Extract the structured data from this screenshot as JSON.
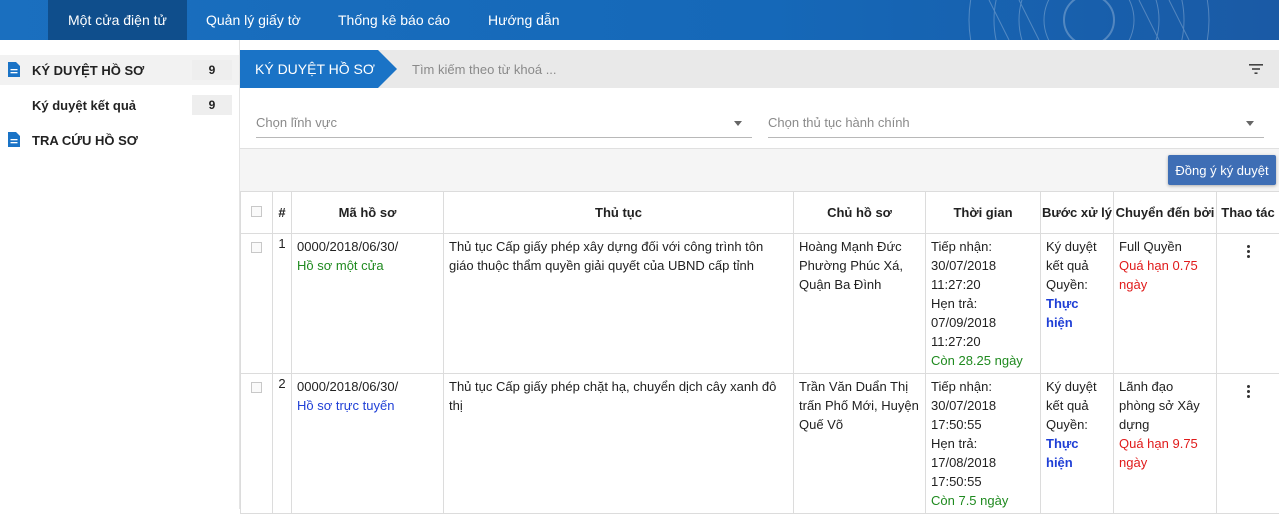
{
  "nav": {
    "items": [
      {
        "label": "Một cửa điện tử",
        "active": true
      },
      {
        "label": "Quản lý giấy tờ"
      },
      {
        "label": "Thống kê báo cáo"
      },
      {
        "label": "Hướng dẫn"
      }
    ]
  },
  "sidebar": {
    "items": [
      {
        "label": "KÝ DUYỆT HỒ SƠ",
        "count": "9",
        "icon": "document-icon"
      },
      {
        "label": "Ký duyệt kết quả",
        "count": "9"
      },
      {
        "label": "TRA CỨU HỒ SƠ",
        "icon": "document-icon"
      }
    ]
  },
  "header": {
    "breadcrumb": "KÝ DUYỆT HỒ SƠ",
    "search_placeholder": "Tìm kiếm theo từ khoá ..."
  },
  "filters": {
    "field_placeholder": "Chọn lĩnh vực",
    "procedure_placeholder": "Chọn thủ tục hành chính"
  },
  "actions": {
    "approve_label": "Đồng ý ký duyệt"
  },
  "table": {
    "headers": [
      "#",
      "Mã hồ sơ",
      "Thủ tục",
      "Chủ hồ sơ",
      "Thời gian",
      "Bước xử lý",
      "Chuyển đến bởi",
      "Thao tác"
    ],
    "rows": [
      {
        "index": "1",
        "code": "0000/2018/06/30/",
        "code_type": "Hồ sơ một cửa",
        "procedure": "Thủ tục Cấp giấy phép xây dựng đối với công trình tôn giáo thuộc thẩm quyền giải quyết của UBND cấp tỉnh",
        "owner": "Hoàng Mạnh Đức Phường Phúc Xá, Quận Ba Đình",
        "received_label": "Tiếp nhận:",
        "received": "30/07/2018 11:27:20",
        "due_label": "Hẹn trả:",
        "due": "07/09/2018 11:27:20",
        "remaining": "Còn 28.25 ngày",
        "step": "Ký duyệt kết quả",
        "permission_label": "Quyền:",
        "permission": "Thực hiện",
        "from": "Full Quyền",
        "overdue": "Quá hạn 0.75 ngày"
      },
      {
        "index": "2",
        "code": "0000/2018/06/30/",
        "code_type": "Hồ sơ trực tuyến",
        "procedure": "Thủ tục Cấp giấy phép chặt hạ, chuyển dịch cây xanh đô thị",
        "owner": "Trần Văn Duẩn Thị trấn Phố Mới, Huyện Quế Võ",
        "received_label": "Tiếp nhận:",
        "received": "30/07/2018 17:50:55",
        "due_label": "Hẹn trả:",
        "due": "17/08/2018 17:50:55",
        "remaining": "Còn 7.5 ngày",
        "step": "Ký duyệt kết quả",
        "permission_label": "Quyền:",
        "permission": "Thực hiện",
        "from": "Lãnh đạo phòng sở Xây dựng",
        "overdue": "Quá hạn 9.75 ngày"
      }
    ]
  },
  "colors": {
    "nav_bg": "#1568b8",
    "nav_active": "#0f4e8c",
    "accent": "#1a73c6",
    "button": "#3e6eb5",
    "green": "#1f8a1f",
    "red": "#e01b1b",
    "blue": "#1f3fd6"
  }
}
